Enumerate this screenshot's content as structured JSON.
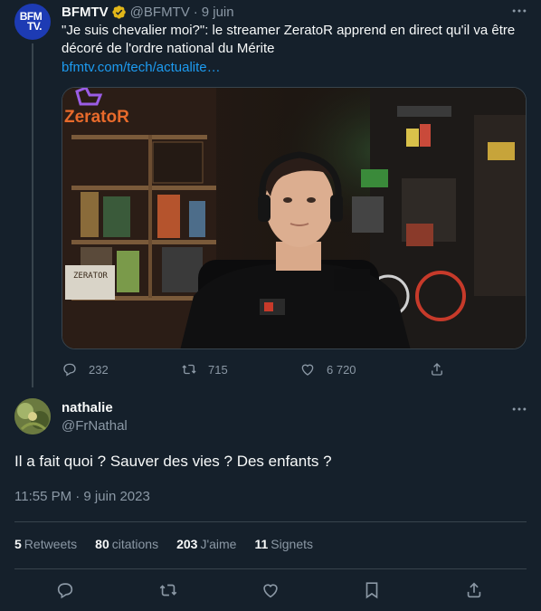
{
  "parent_tweet": {
    "avatar_text_line1": "BFM",
    "avatar_text_line2": "TV.",
    "name": "BFMTV",
    "handle": "@BFMTV",
    "separator": "·",
    "date": "9 juin",
    "text": "\"Je suis chevalier moi?\": le streamer ZeratoR apprend en direct qu'il va être décoré de l'ordre national du Mérite",
    "link": "bfmtv.com/tech/actualite…",
    "media_labels": {
      "logo": "ZeratoR",
      "sign": "ZERATOR"
    },
    "actions": {
      "reply_count": "232",
      "retweet_count": "715",
      "like_count": "6 720"
    }
  },
  "reply_tweet": {
    "name": "nathalie",
    "handle": "@FrNathal",
    "text": "Il a fait quoi ? Sauver des vies ? Des enfants ?",
    "timestamp": "11:55 PM · 9 juin 2023",
    "stats": [
      {
        "value": "5",
        "label": "Retweets"
      },
      {
        "value": "80",
        "label": "citations"
      },
      {
        "value": "203",
        "label": "J'aime"
      },
      {
        "value": "11",
        "label": "Signets"
      }
    ]
  },
  "colors": {
    "background": "#15202b",
    "text": "#f7f9f9",
    "muted": "#8b98a5",
    "link": "#1d9bf0",
    "verified": "#e2b719",
    "divider": "#38444d"
  },
  "icons": {
    "more": "more-dots-icon",
    "reply": "reply-icon",
    "retweet": "retweet-icon",
    "like": "heart-icon",
    "bookmark": "bookmark-icon",
    "share": "share-icon",
    "verified": "verified-badge-icon"
  }
}
